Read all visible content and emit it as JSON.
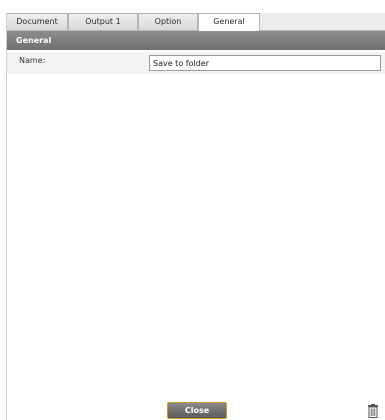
{
  "tabs": [
    {
      "label": "Document",
      "active": false
    },
    {
      "label": "Output 1",
      "active": false
    },
    {
      "label": "Option",
      "active": false
    },
    {
      "label": "General",
      "active": true
    }
  ],
  "section": {
    "title": "General"
  },
  "fields": {
    "name_label": "Name:",
    "name_value": "Save to folder"
  },
  "footer": {
    "close_label": "Close",
    "trash_icon": "trash-icon"
  },
  "colors": {
    "header_bg": "#7a7a7a",
    "close_border": "#c99a2a"
  }
}
